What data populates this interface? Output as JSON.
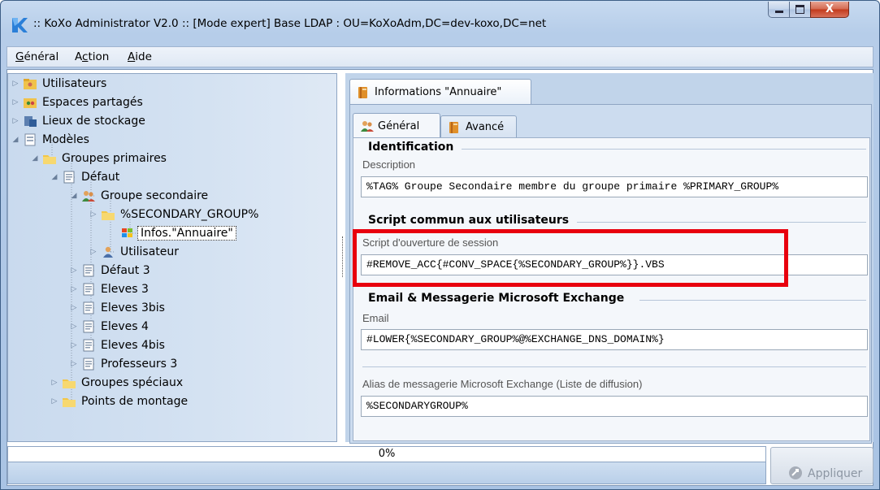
{
  "window": {
    "title": ":: KoXo Administrator V2.0 :: [Mode expert] Base LDAP : OU=KoXoAdm,DC=dev-koxo,DC=net",
    "close_glyph": "X"
  },
  "menu": [
    {
      "underline": "G",
      "rest": "énéral"
    },
    {
      "prefix": "A",
      "underline": "c",
      "rest": "tion"
    },
    {
      "underline": "A",
      "rest": "ide"
    }
  ],
  "tree": [
    {
      "label": "Utilisateurs",
      "icon": "users-folder-icon",
      "expanded": false
    },
    {
      "label": "Espaces partagés",
      "icon": "shared-spaces-icon",
      "expanded": false
    },
    {
      "label": "Lieux de stockage",
      "icon": "storage-icon",
      "expanded": false
    },
    {
      "label": "Modèles",
      "icon": "models-icon",
      "expanded": true
    },
    {
      "label": "Groupes primaires",
      "icon": "folder-icon",
      "expanded": true
    },
    {
      "label": "Défaut",
      "icon": "template-icon",
      "expanded": true
    },
    {
      "label": "Groupe secondaire",
      "icon": "group-icon",
      "expanded": true
    },
    {
      "label": "%SECONDARY_GROUP%",
      "icon": "folder-icon",
      "expanded": false
    },
    {
      "label": "Infos.\"Annuaire\"",
      "icon": "windows-flag-icon",
      "selected": true
    },
    {
      "label": "Utilisateur",
      "icon": "user-icon",
      "expanded": false
    },
    {
      "label": "Défaut 3",
      "icon": "template-icon",
      "expanded": false
    },
    {
      "label": "Eleves 3",
      "icon": "template-icon",
      "expanded": false
    },
    {
      "label": "Eleves 3bis",
      "icon": "template-icon",
      "expanded": false
    },
    {
      "label": "Eleves 4",
      "icon": "template-icon",
      "expanded": false
    },
    {
      "label": "Eleves 4bis",
      "icon": "template-icon",
      "expanded": false
    },
    {
      "label": "Professeurs 3",
      "icon": "template-icon",
      "expanded": false
    },
    {
      "label": "Groupes spéciaux",
      "icon": "folder-icon",
      "expanded": false
    },
    {
      "label": "Points de montage",
      "icon": "folder-icon",
      "expanded": false
    }
  ],
  "tabs": {
    "main": "Informations \"Annuaire\"",
    "general": "Général",
    "advanced": "Avancé"
  },
  "sections": {
    "identification": {
      "title": "Identification",
      "description_label": "Description",
      "description_value": "%TAG% Groupe Secondaire membre du groupe primaire %PRIMARY_GROUP%"
    },
    "script": {
      "title": "Script commun aux utilisateurs",
      "label": "Script d'ouverture de session",
      "value": "#REMOVE_ACC{#CONV_SPACE{%SECONDARY_GROUP%}}.VBS"
    },
    "email": {
      "title": "Email & Messagerie Microsoft Exchange",
      "email_label": "Email",
      "email_value": "#LOWER{%SECONDARY_GROUP%@%EXCHANGE_DNS_DOMAIN%}",
      "alias_label": "Alias de messagerie Microsoft Exchange (Liste de diffusion)",
      "alias_value": "%SECONDARYGROUP%"
    }
  },
  "progress": {
    "text": "0%",
    "value": 0
  },
  "apply_label": "Appliquer",
  "colors": {
    "highlight": "#e8000e",
    "window_frame": "#b6cde9"
  }
}
